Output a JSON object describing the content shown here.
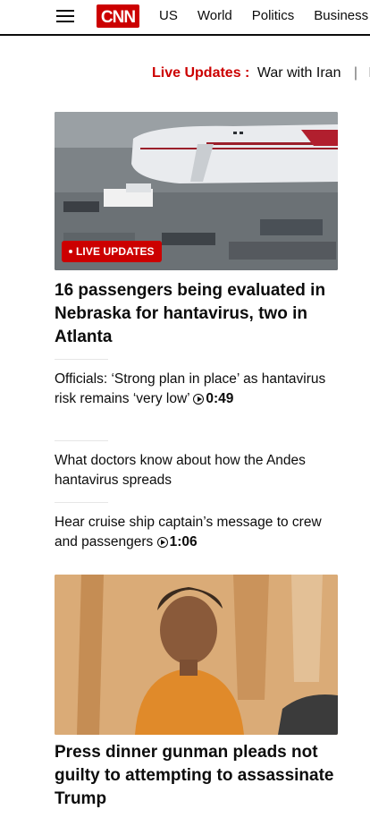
{
  "header": {
    "logo_text": "CNN",
    "nav": [
      "US",
      "World",
      "Politics",
      "Business"
    ]
  },
  "ticker": {
    "live_label": "Live Updates :",
    "topic": "War with Iran",
    "separator": "|",
    "next": "H"
  },
  "stories": [
    {
      "badge": "LIVE UPDATES",
      "headline": "16 passengers being evaluated in Nebraska for hantavirus, two in Atlanta",
      "image": "airplane-tarmac-photo"
    },
    {
      "headline": "Press dinner gunman pleads not guilty to attempting to assassinate Trump",
      "image": "courtroom-sketch"
    }
  ],
  "related": [
    {
      "text": "Officials: ‘Strong plan in place’ as hantavirus risk remains ‘very low’",
      "duration": "0:49"
    },
    {
      "text": "What doctors know about how the Andes hantavirus spreads"
    },
    {
      "text": "Hear cruise ship captain’s message to crew and passengers",
      "duration": "1:06"
    }
  ],
  "colors": {
    "brand_red": "#cc0000",
    "text": "#0c0c0c"
  }
}
